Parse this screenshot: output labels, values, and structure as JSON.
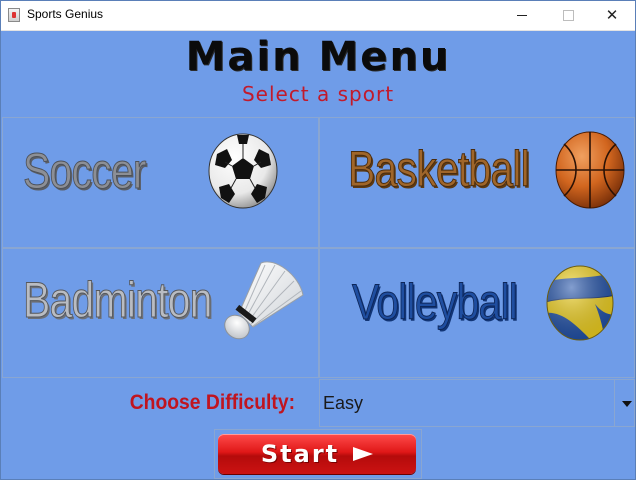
{
  "window": {
    "title": "Sports Genius",
    "app_icon": "java-cup-icon",
    "controls": {
      "minimize": "minimize-icon",
      "maximize": "maximize-icon",
      "close": "✕"
    }
  },
  "header": {
    "title": "Main Menu",
    "subtitle": "Select a sport"
  },
  "sports": [
    {
      "label": "Soccer",
      "icon": "soccer-ball-icon"
    },
    {
      "label": "Basketball",
      "icon": "basketball-icon"
    },
    {
      "label": "Badminton",
      "icon": "shuttlecock-icon"
    },
    {
      "label": "Volleyball",
      "icon": "volleyball-icon"
    }
  ],
  "difficulty": {
    "label": "Choose Difficulty:",
    "selected": "Easy"
  },
  "start_button": {
    "label": "Start"
  },
  "colors": {
    "background": "#6f9ce8",
    "accent_red": "#c21a2b",
    "button_red": "#e01818"
  }
}
